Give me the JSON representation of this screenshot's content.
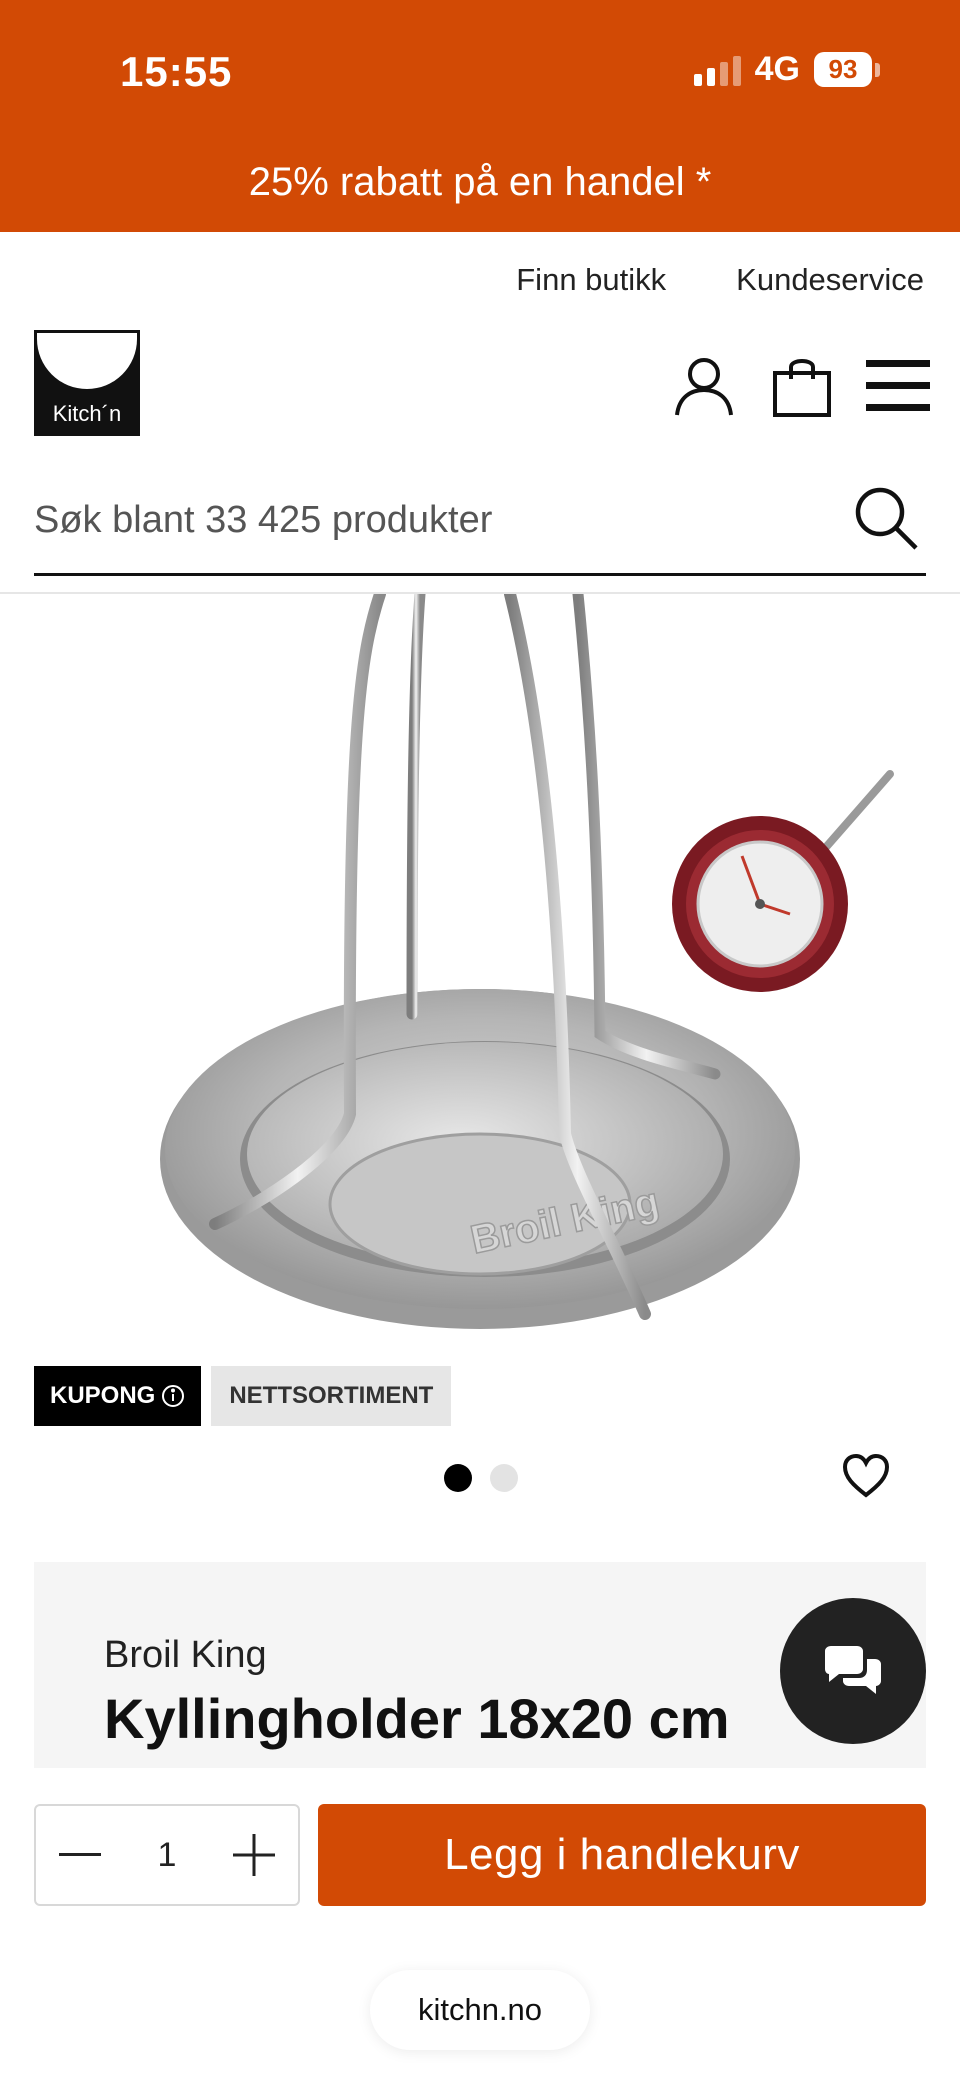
{
  "status_bar": {
    "time": "15:55",
    "network": "4G",
    "battery": "93",
    "icons": [
      "signal-icon",
      "battery-icon"
    ]
  },
  "promo_banner": {
    "text": "25% rabatt på en handel *"
  },
  "utility_nav": {
    "find_store": "Finn butikk",
    "customer_service": "Kundeservice"
  },
  "header": {
    "logo_text": "Kitch´n",
    "icons": [
      "account-icon",
      "cart-icon",
      "menu-icon"
    ]
  },
  "search": {
    "placeholder": "Søk blant 33 425 produkter",
    "icon": "search-icon"
  },
  "product": {
    "image_alt": "Broil King kyllingholder med termometer",
    "badges": {
      "coupon": "KUPONG",
      "web_only": "NETTSORTIMENT"
    },
    "gallery": {
      "total_images": 2,
      "active_index": 0
    },
    "brand": "Broil King",
    "title": "Kyllingholder 18x20 cm"
  },
  "purchase": {
    "quantity": "1",
    "add_to_cart_label": "Legg i handlekurv"
  },
  "browser": {
    "url": "kitchn.no"
  },
  "colors": {
    "brand_orange": "#d24a05",
    "black": "#111111",
    "card_bg": "#f5f5f5"
  }
}
